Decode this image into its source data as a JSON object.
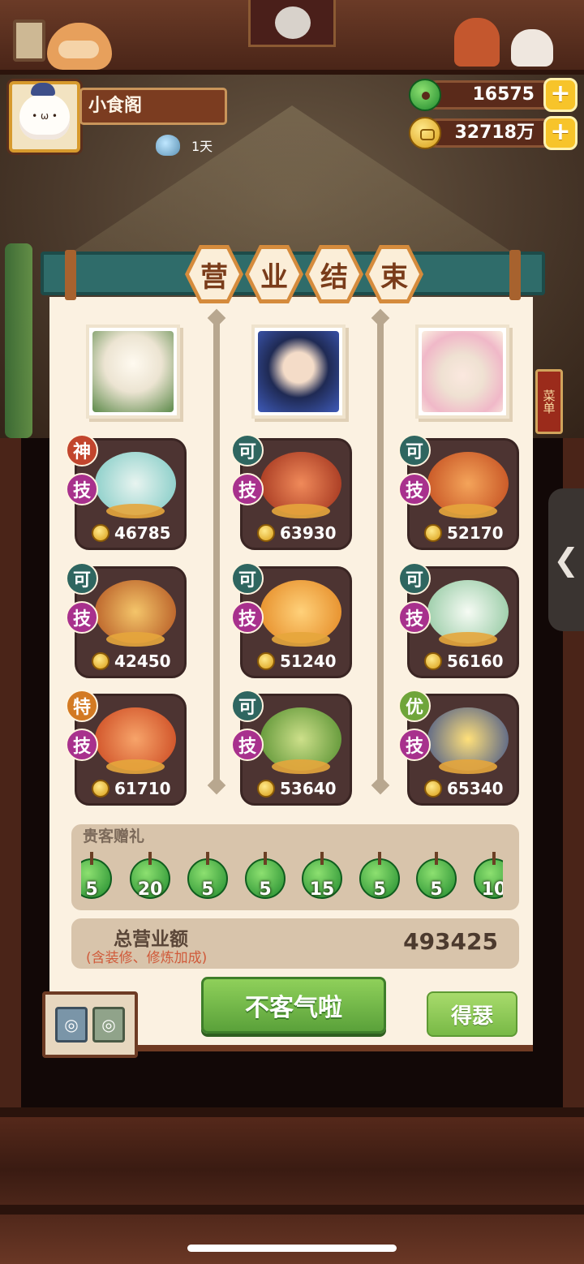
{
  "header": {
    "restaurant_name": "小食阁",
    "days": "1天",
    "jade_amount": "16575",
    "coin_amount": "32718万",
    "add_symbol": "+"
  },
  "title": [
    "营",
    "业",
    "结",
    "束"
  ],
  "chefs": [
    {
      "dishes": [
        {
          "rank": "神",
          "skill": "技",
          "price": "46785",
          "color": "#7ac8c2"
        },
        {
          "rank": "可",
          "skill": "技",
          "price": "42450",
          "color": "#e39a3c"
        },
        {
          "rank": "特",
          "skill": "技",
          "price": "61710",
          "color": "#e0673a"
        }
      ]
    },
    {
      "dishes": [
        {
          "rank": "可",
          "skill": "技",
          "price": "63930",
          "color": "#d9623b"
        },
        {
          "rank": "可",
          "skill": "技",
          "price": "51240",
          "color": "#ec9a2c"
        },
        {
          "rank": "可",
          "skill": "技",
          "price": "53640",
          "color": "#7ab04a"
        }
      ]
    },
    {
      "dishes": [
        {
          "rank": "可",
          "skill": "技",
          "price": "52170",
          "color": "#e07a3a"
        },
        {
          "rank": "可",
          "skill": "技",
          "price": "56160",
          "color": "#b9dcc2"
        },
        {
          "rank": "优",
          "skill": "技",
          "price": "65340",
          "color": "#e7b94a"
        }
      ]
    }
  ],
  "gifts": {
    "title": "贵客赠礼",
    "items": [
      "5",
      "20",
      "5",
      "5",
      "15",
      "5",
      "5",
      "10"
    ]
  },
  "total": {
    "label": "总营业额",
    "note": "(含装修、修炼加成)",
    "value": "493425"
  },
  "buttons": {
    "main": "不客气啦",
    "side": "得瑟"
  },
  "side_panel": {
    "menu_label": "菜单",
    "handle_glyph": "❮"
  },
  "colors": {
    "accent_green": "#5aa13a",
    "banner_teal": "#2f6c6a",
    "skill_purple": "#a8318d",
    "rank_shen": "#c2452d",
    "rank_ke": "#2f6660",
    "rank_te": "#d37a23",
    "rank_you": "#6fa53a"
  },
  "icons": {
    "jade": "jade-coin-icon",
    "coin": "gold-coin-icon",
    "gem": "gem-icon"
  }
}
